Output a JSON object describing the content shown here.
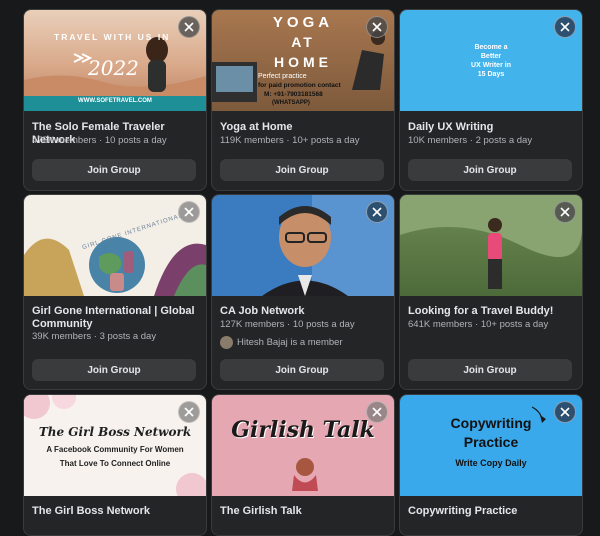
{
  "cards": [
    {
      "title": "The Solo Female Traveler Network",
      "meta": "475K members · 10 posts a day",
      "join": "Join Group",
      "img_text": {
        "line1": "TRAVEL WITH US IN",
        "line2": "2022",
        "url": "WWW.SOFETRAVEL.COM"
      }
    },
    {
      "title": "Yoga at Home",
      "meta": "119K members · 10+ posts a day",
      "join": "Join Group",
      "img_text": {
        "l1": "YOGA",
        "l2": "AT",
        "l3": "HOME",
        "l4": "Perfect practice",
        "l5": "for paid promotion contact",
        "l6": "M: +91-7903181568",
        "l7": "(WHATSAPP)"
      }
    },
    {
      "title": "Daily UX Writing",
      "meta": "10K members · 2 posts a day",
      "join": "Join Group",
      "img_text": {
        "l1": "Become a",
        "l2": "Better",
        "l3": "UX Writer in",
        "l4": "15 Days"
      }
    },
    {
      "title": "Girl Gone International | Global Community",
      "meta": "39K members · 3 posts a day",
      "join": "Join Group",
      "img_text": {
        "arc": "GIRL GONE INTERNATIONAL"
      }
    },
    {
      "title": "CA Job Network",
      "meta": "127K members · 10 posts a day",
      "member": "Hitesh Bajaj is a member",
      "join": "Join Group"
    },
    {
      "title": "Looking for a Travel Buddy!",
      "meta": "641K members · 10+ posts a day",
      "join": "Join Group"
    },
    {
      "title": "The Girl Boss Network",
      "img_text": {
        "l1": "The Girl Boss Network",
        "l2": "A Facebook Community For Women",
        "l3": "That Love To Connect Online"
      }
    },
    {
      "title": "The Girlish Talk",
      "img_text": {
        "l1": "Girlish Talk"
      }
    },
    {
      "title": "Copywriting Practice",
      "img_text": {
        "l1": "Copywriting",
        "l2": "Practice",
        "l3": "Write Copy Daily"
      }
    }
  ],
  "icons": {
    "close": "close-icon"
  }
}
